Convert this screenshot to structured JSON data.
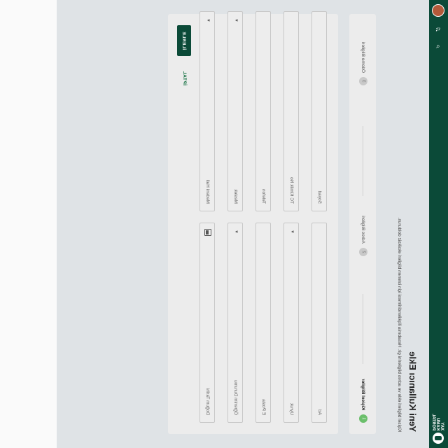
{
  "header": {
    "logo_text": "XAY KAMU PORTAL",
    "menu_icon": "menu-icon",
    "icons": [
      "search-icon",
      "bell-icon",
      "user-avatar"
    ]
  },
  "page": {
    "title": "Yeni Kullanıcı Ekle",
    "description": "Kişisel bilgileri ekle ve adres bilgilerini gir. Hesabınla ilişkilendirilmesi için istenen bilgileri eksiksiz doldurun."
  },
  "stepper": {
    "steps": [
      {
        "number": "1",
        "label": "Kişisel Bilgiler",
        "state": "active"
      },
      {
        "number": "2",
        "label": "Adres Bilgileri",
        "state": "pending"
      },
      {
        "number": "3",
        "label": "Ödeme Bilgileri",
        "state": "pending"
      }
    ]
  },
  "form": {
    "left": [
      {
        "placeholder": "Ad",
        "type": "text"
      },
      {
        "placeholder": "Uyruk",
        "type": "select"
      },
      {
        "placeholder": "E Posta",
        "type": "text"
      },
      {
        "placeholder": "Öğrenim Durumu",
        "type": "select"
      },
      {
        "placeholder": "Doğum Tarihi",
        "type": "date"
      }
    ],
    "right": [
      {
        "placeholder": "Soyad",
        "type": "text"
      },
      {
        "placeholder": "TC Kimlik No",
        "type": "text"
      },
      {
        "placeholder": "Telefon",
        "type": "text"
      },
      {
        "placeholder": "Meslek",
        "type": "select"
      },
      {
        "placeholder": "Medeni Hali",
        "type": "select"
      }
    ]
  },
  "actions": {
    "cancel_label": "İPTAL",
    "next_label": "İLERLE"
  },
  "colors": {
    "brand": "#0b4a38",
    "accent_green": "#6bbf6b"
  }
}
